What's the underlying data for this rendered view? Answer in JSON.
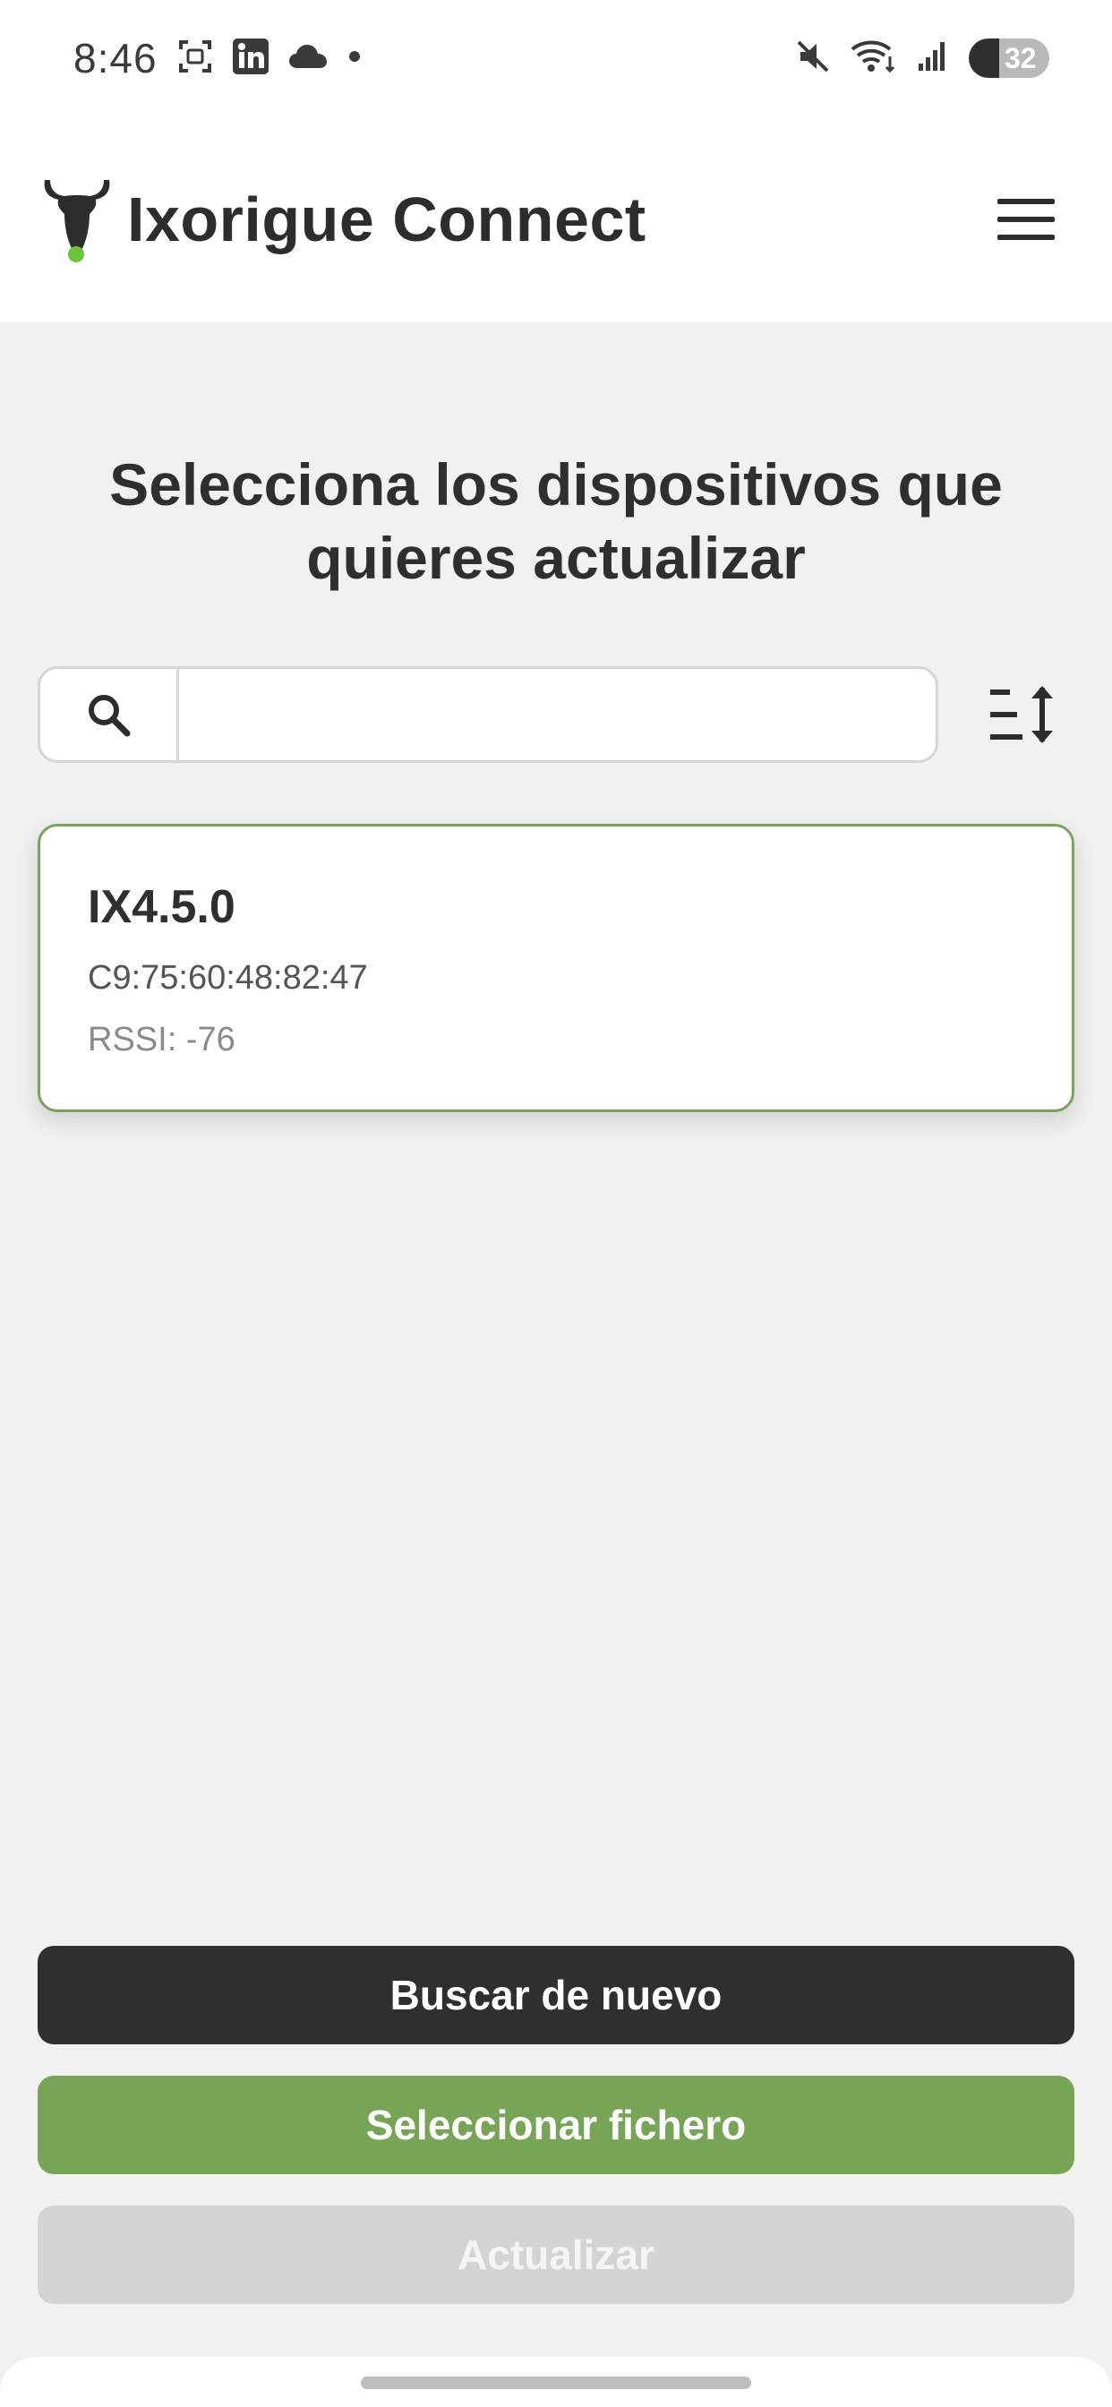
{
  "status_bar": {
    "time": "8:46",
    "battery": "32",
    "icons": [
      "screenshot-icon",
      "linkedin-icon",
      "cloud-icon",
      "dot-icon",
      "mute-icon",
      "wifi-icon",
      "signal-icon",
      "battery-icon"
    ]
  },
  "header": {
    "title": "Ixorigue Connect",
    "logo_icon": "bull-logo-icon",
    "menu_icon": "hamburger-menu-icon"
  },
  "main": {
    "heading": "Selecciona los dispositivos que quieres actualizar",
    "search": {
      "placeholder": "",
      "value": ""
    },
    "sort_icon": "sort-icon",
    "devices": [
      {
        "name": "IX4.5.0",
        "mac": "C9:75:60:48:82:47",
        "rssi": "RSSI: -76"
      }
    ]
  },
  "actions": {
    "rescan_label": "Buscar de nuevo",
    "select_file_label": "Seleccionar fichero",
    "update_label": "Actualizar"
  },
  "colors": {
    "accent_green": "#76a655",
    "dark": "#2f2f2f",
    "disabled": "#d4d4d4",
    "background": "#f1f1f1"
  }
}
